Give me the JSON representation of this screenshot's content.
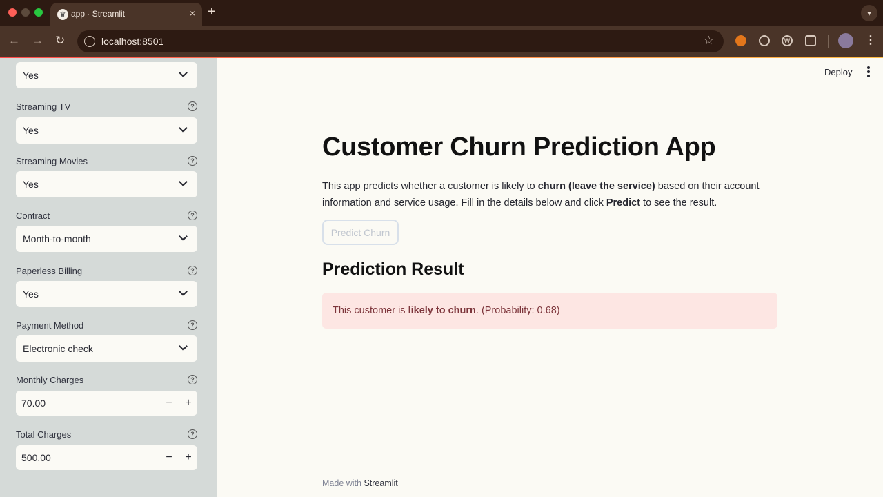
{
  "browser": {
    "tab_title": "app · Streamlit",
    "tab_close": "×",
    "new_tab": "+",
    "url": "localhost:8501",
    "icons": [
      "streamlit-favicon",
      "back-arrow-icon",
      "forward-arrow-icon",
      "reload-icon",
      "site-info-icon",
      "star-icon",
      "extension-icons",
      "profile-avatar",
      "menu-icon"
    ]
  },
  "header": {
    "deploy_label": "Deploy"
  },
  "sidebar": {
    "top_select_value": "Yes",
    "fields": [
      {
        "label": "Streaming TV",
        "value": "Yes"
      },
      {
        "label": "Streaming Movies",
        "value": "Yes"
      },
      {
        "label": "Contract",
        "value": "Month-to-month"
      },
      {
        "label": "Paperless Billing",
        "value": "Yes"
      },
      {
        "label": "Payment Method",
        "value": "Electronic check"
      }
    ],
    "numbers": [
      {
        "label": "Monthly Charges",
        "value": "70.00"
      },
      {
        "label": "Total Charges",
        "value": "500.00"
      }
    ],
    "help_glyph": "?",
    "minus": "−",
    "plus": "+"
  },
  "main": {
    "title": "Customer Churn Prediction App",
    "intro": {
      "t1": "This app predicts whether a customer is likely to ",
      "b1": "churn (leave the service)",
      "t2": " based on their account information and service usage. Fill in the details below and click ",
      "b2": "Predict",
      "t3": " to see the result."
    },
    "predict_button": "Predict Churn",
    "result_heading": "Prediction Result",
    "result": {
      "t1": "This customer is ",
      "b1": "likely to churn",
      "t2": ". (Probability: 0.68)"
    },
    "footer": {
      "made_with": "Made with ",
      "brand": "Streamlit"
    }
  },
  "colors": {
    "sidebar_bg": "#d5dad8",
    "main_bg": "#fbfaf4",
    "alert_bg": "#fde6e3",
    "alert_text": "#7d353b"
  }
}
